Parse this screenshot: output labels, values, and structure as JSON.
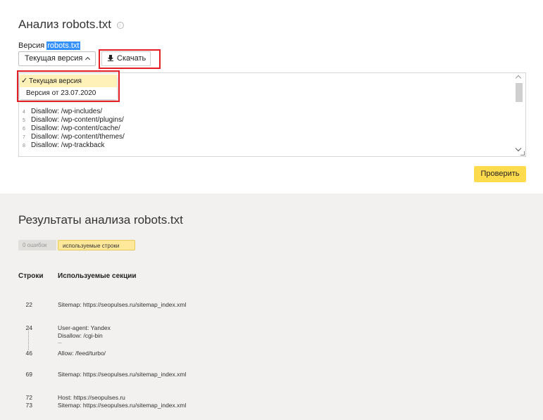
{
  "header": {
    "title": "Анализ robots.txt",
    "info_icon": "ⓘ",
    "version_label": "Версия",
    "version_file": "robots.txt"
  },
  "controls": {
    "version_select": "Текущая версия",
    "download_label": "Скачать"
  },
  "dropdown": {
    "selected_mark": "✓",
    "options": [
      "Текущая версия",
      "Версия от 23.07.2020"
    ]
  },
  "editor": {
    "lines": [
      {
        "n": "4",
        "text": "Disallow: /wp-includes/"
      },
      {
        "n": "5",
        "text": "Disallow: /wp-content/plugins/"
      },
      {
        "n": "6",
        "text": "Disallow: /wp-content/cache/"
      },
      {
        "n": "7",
        "text": "Disallow: /wp-content/themes/"
      },
      {
        "n": "8",
        "text": "Disallow: /wp-trackback"
      }
    ]
  },
  "actions": {
    "check_label": "Проверить"
  },
  "results": {
    "title": "Результаты анализа robots.txt",
    "tabs": {
      "errors": "0 ошибок",
      "used": "используемые строки"
    },
    "columns": {
      "lines": "Строки",
      "sections": "Используемые секции"
    },
    "rows": [
      {
        "num": "22",
        "text": "Sitemap: https://seopulses.ru/sitemap_index.xml"
      },
      {
        "num": "24",
        "text": "User-agent: Yandex"
      },
      {
        "num": "",
        "text": "Disallow: /cgi-bin"
      },
      {
        "num": "",
        "text": "..."
      },
      {
        "num": "46",
        "text": "Allow: /feed/turbo/"
      },
      {
        "num": "69",
        "text": "Sitemap: https://seopulses.ru/sitemap_index.xml"
      },
      {
        "num": "72",
        "text": "Host: https://seopulses.ru"
      },
      {
        "num": "73",
        "text": "Sitemap: https://seopulses.ru/sitemap_index.xml"
      }
    ]
  },
  "colors": {
    "accent_yellow": "#ffdb4d",
    "highlight_red": "#e31e24",
    "selection_blue": "#3390ff",
    "dropdown_selected": "#fff1b8",
    "results_bg": "#f2f1ef"
  }
}
